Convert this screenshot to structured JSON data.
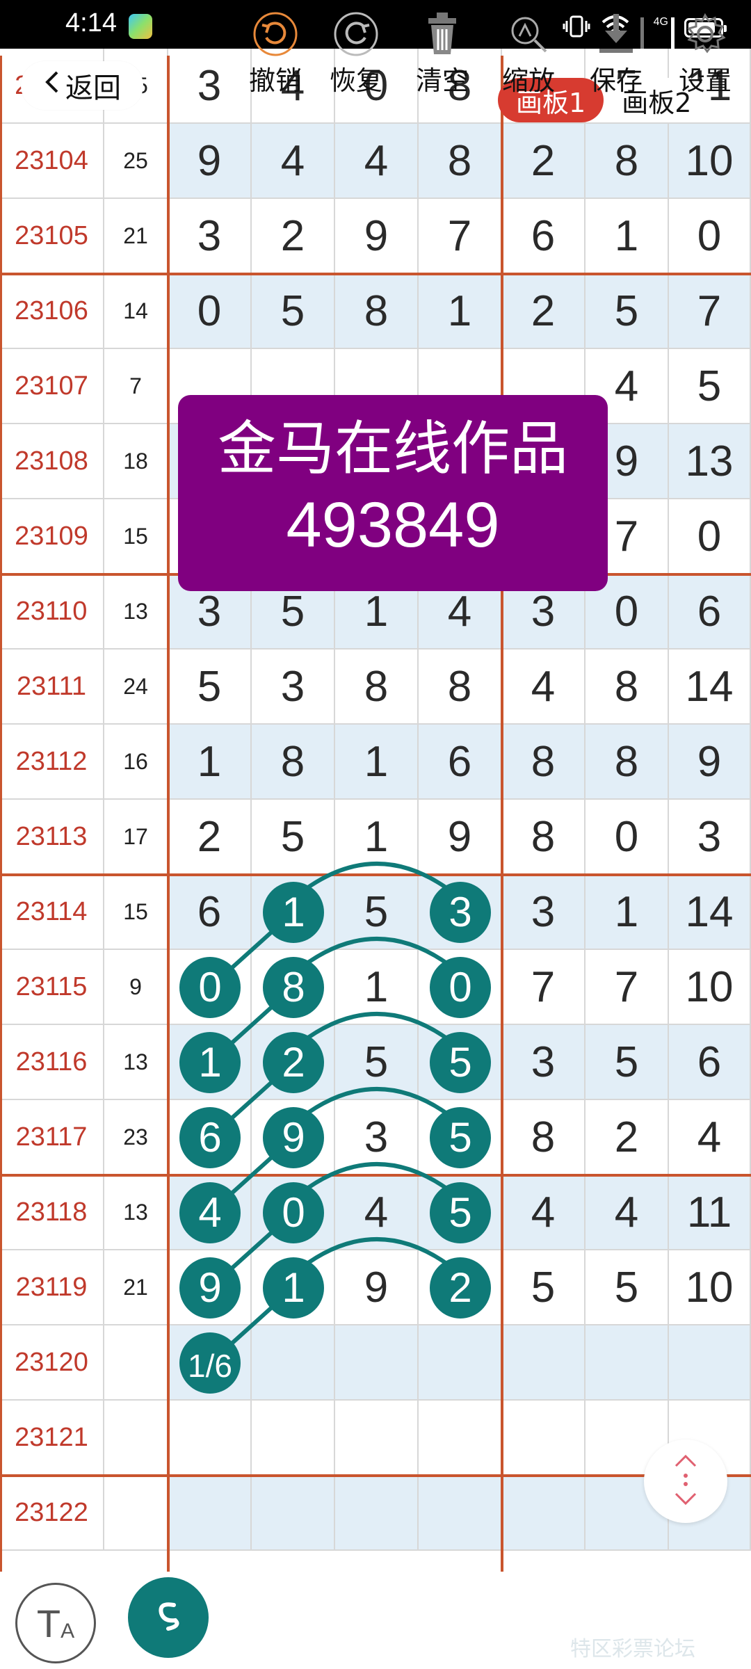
{
  "status_bar": {
    "time": "4:14",
    "network": "4G"
  },
  "header": {
    "back_label": "返回",
    "tabs": [
      {
        "label": "画板1",
        "active": true
      },
      {
        "label": "画板2",
        "active": false
      }
    ]
  },
  "colors": {
    "accent_red": "#d73b30",
    "grid_line": "#c9552e",
    "period_text": "#c0392b",
    "teal": "#0f7a78",
    "watermark_bg": "#800080",
    "row_alt": "#e2eef7"
  },
  "watermark": {
    "line1": "金马在线作品",
    "line2": "493849"
  },
  "rows": [
    {
      "period": "23103",
      "sum": "15",
      "nums": [
        "3",
        "4",
        "0",
        "8",
        "",
        "5",
        "11"
      ]
    },
    {
      "period": "23104",
      "sum": "25",
      "nums": [
        "9",
        "4",
        "4",
        "8",
        "2",
        "8",
        "10"
      ]
    },
    {
      "period": "23105",
      "sum": "21",
      "nums": [
        "3",
        "2",
        "9",
        "7",
        "6",
        "1",
        "0"
      ]
    },
    {
      "period": "23106",
      "sum": "14",
      "nums": [
        "0",
        "5",
        "8",
        "1",
        "2",
        "5",
        "7"
      ]
    },
    {
      "period": "23107",
      "sum": "7",
      "nums": [
        "",
        "",
        "",
        "",
        "",
        "4",
        "5"
      ]
    },
    {
      "period": "23108",
      "sum": "18",
      "nums": [
        "",
        "",
        "",
        "",
        "",
        "9",
        "13"
      ]
    },
    {
      "period": "23109",
      "sum": "15",
      "nums": [
        "",
        "",
        "",
        "",
        "",
        "7",
        "0"
      ]
    },
    {
      "period": "23110",
      "sum": "13",
      "nums": [
        "3",
        "5",
        "1",
        "4",
        "3",
        "0",
        "6"
      ]
    },
    {
      "period": "23111",
      "sum": "24",
      "nums": [
        "5",
        "3",
        "8",
        "8",
        "4",
        "8",
        "14"
      ]
    },
    {
      "period": "23112",
      "sum": "16",
      "nums": [
        "1",
        "8",
        "1",
        "6",
        "8",
        "8",
        "9"
      ]
    },
    {
      "period": "23113",
      "sum": "17",
      "nums": [
        "2",
        "5",
        "1",
        "9",
        "8",
        "0",
        "3"
      ]
    },
    {
      "period": "23114",
      "sum": "15",
      "nums": [
        "6",
        "1",
        "5",
        "3",
        "3",
        "1",
        "14"
      ]
    },
    {
      "period": "23115",
      "sum": "9",
      "nums": [
        "0",
        "8",
        "1",
        "0",
        "7",
        "7",
        "10"
      ]
    },
    {
      "period": "23116",
      "sum": "13",
      "nums": [
        "1",
        "2",
        "5",
        "5",
        "3",
        "5",
        "6"
      ]
    },
    {
      "period": "23117",
      "sum": "23",
      "nums": [
        "6",
        "9",
        "3",
        "5",
        "8",
        "2",
        "4"
      ]
    },
    {
      "period": "23118",
      "sum": "13",
      "nums": [
        "4",
        "0",
        "4",
        "5",
        "4",
        "4",
        "11"
      ]
    },
    {
      "period": "23119",
      "sum": "21",
      "nums": [
        "9",
        "1",
        "9",
        "2",
        "5",
        "5",
        "10"
      ]
    },
    {
      "period": "23120",
      "sum": "",
      "nums": [
        "1/6",
        "",
        "",
        "",
        "",
        "",
        ""
      ]
    },
    {
      "period": "23121",
      "sum": "",
      "nums": [
        "",
        "",
        "",
        "",
        "",
        "",
        ""
      ]
    },
    {
      "period": "23122",
      "sum": "",
      "nums": [
        "",
        "",
        "",
        "",
        "",
        "",
        ""
      ]
    }
  ],
  "highlights": [
    {
      "row": 11,
      "col": 1
    },
    {
      "row": 11,
      "col": 3
    },
    {
      "row": 12,
      "col": 0
    },
    {
      "row": 12,
      "col": 1
    },
    {
      "row": 12,
      "col": 3
    },
    {
      "row": 13,
      "col": 0
    },
    {
      "row": 13,
      "col": 1
    },
    {
      "row": 13,
      "col": 3
    },
    {
      "row": 14,
      "col": 0
    },
    {
      "row": 14,
      "col": 1
    },
    {
      "row": 14,
      "col": 3
    },
    {
      "row": 15,
      "col": 0
    },
    {
      "row": 15,
      "col": 1
    },
    {
      "row": 15,
      "col": 3
    },
    {
      "row": 16,
      "col": 0
    },
    {
      "row": 16,
      "col": 1
    },
    {
      "row": 16,
      "col": 3
    },
    {
      "row": 17,
      "col": 0
    }
  ],
  "toolbar": {
    "font_icon": "T",
    "font_icon_sub": "A",
    "items": [
      {
        "label": "撤销",
        "icon": "undo-icon"
      },
      {
        "label": "恢复",
        "icon": "redo-icon"
      },
      {
        "label": "清空",
        "icon": "trash-icon"
      },
      {
        "label": "缩放",
        "icon": "zoom-icon"
      },
      {
        "label": "保存",
        "icon": "download-icon"
      },
      {
        "label": "设置",
        "icon": "gear-icon"
      }
    ]
  },
  "corner_logo": "特区彩票论坛"
}
